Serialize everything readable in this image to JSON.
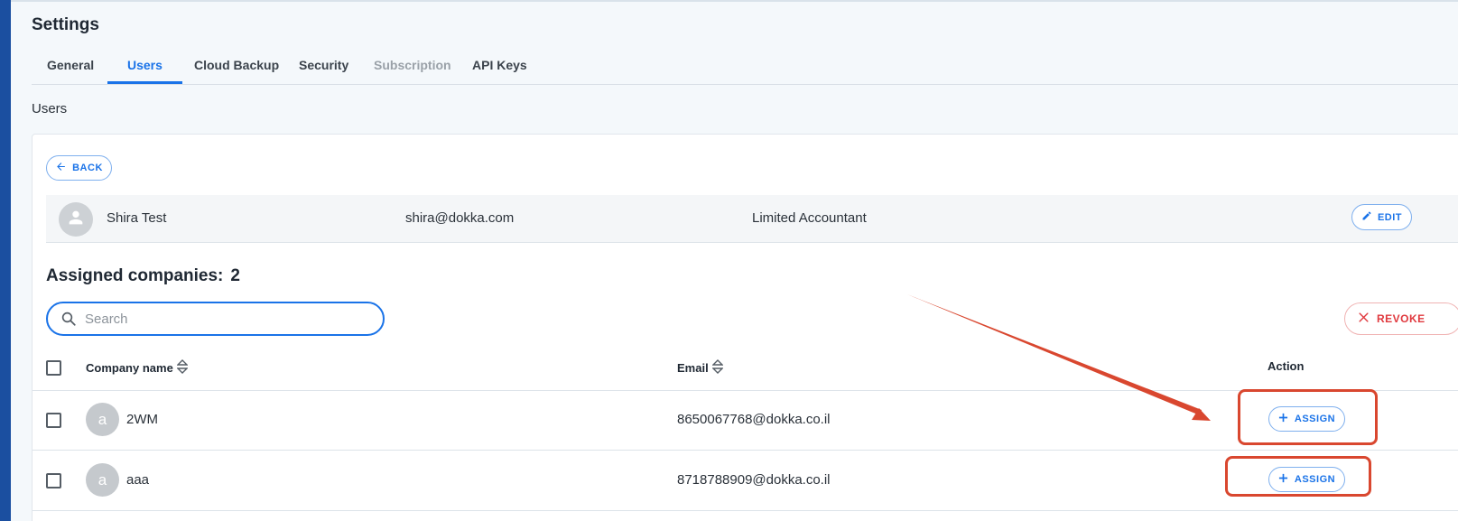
{
  "page": {
    "title": "Settings",
    "section_label": "Users"
  },
  "tabs": [
    {
      "label": "General",
      "state": "normal"
    },
    {
      "label": "Users",
      "state": "active"
    },
    {
      "label": "Cloud Backup",
      "state": "normal"
    },
    {
      "label": "Security",
      "state": "normal"
    },
    {
      "label": "Subscription",
      "state": "disabled"
    },
    {
      "label": "API Keys",
      "state": "normal"
    }
  ],
  "back_button": {
    "label": "BACK",
    "icon": "arrow-left-icon"
  },
  "user": {
    "name": "Shira Test",
    "email": "shira@dokka.com",
    "role": "Limited Accountant",
    "edit_label": "EDIT",
    "avatar_icon": "person-icon"
  },
  "assigned": {
    "label": "Assigned companies:",
    "count": "2"
  },
  "search": {
    "placeholder": "Search",
    "value": ""
  },
  "revoke_button": {
    "label": "REVOKE"
  },
  "table": {
    "columns": {
      "company": "Company name",
      "email": "Email",
      "action": "Action"
    },
    "rows": [
      {
        "initial": "a",
        "name": "2WM",
        "email": "8650067768@dokka.co.il",
        "action_label": "ASSIGN"
      },
      {
        "initial": "a",
        "name": "aaa",
        "email": "8718788909@dokka.co.il",
        "action_label": "ASSIGN"
      }
    ]
  },
  "colors": {
    "accent": "#1a73e8",
    "danger": "#e0393e",
    "annotation": "#d9472f",
    "sidebar": "#1b4fa0"
  }
}
